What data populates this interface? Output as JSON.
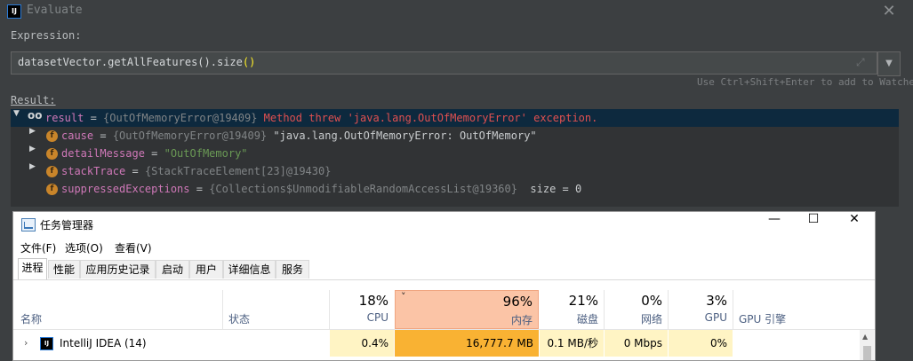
{
  "dialog": {
    "logo": "IJ",
    "title": "Evaluate",
    "close": "✕",
    "expression_label": "Expression:",
    "expression_prefix": "datasetVector.getAllFeatures().size",
    "expression_parens": "()",
    "dropdown": "▼",
    "hint": "Use Ctrl+Shift+Enter to add to Watches",
    "result_label": "Result:"
  },
  "result_tree": {
    "root": {
      "expand": "▼",
      "icon": "oo",
      "name": "result",
      "eq": " = ",
      "ref": "{OutOfMemoryError@19409}",
      "message": " Method threw 'java.lang.OutOfMemoryError' exception."
    },
    "children": [
      {
        "expand": "▶",
        "icon": "f",
        "name": "cause",
        "eq": " = ",
        "ref": "{OutOfMemoryError@19409}",
        "value": " \"java.lang.OutOfMemoryError: OutOfMemory\""
      },
      {
        "expand": "▶",
        "icon": "f",
        "name": "detailMessage",
        "eq": " = ",
        "ref": "",
        "value": "\"OutOfMemory\""
      },
      {
        "expand": "▶",
        "icon": "f",
        "name": "stackTrace",
        "eq": " = ",
        "ref": "{StackTraceElement[23]@19430}",
        "value": ""
      },
      {
        "expand": "",
        "icon": "f",
        "name": "suppressedExceptions",
        "eq": " = ",
        "ref": "{Collections$UnmodifiableRandomAccessList@19360}",
        "value": "  size = 0"
      }
    ]
  },
  "task_manager": {
    "title": "任务管理器",
    "window_buttons": {
      "minimize": "—",
      "maximize": "☐",
      "close": "✕"
    },
    "menu": [
      "文件(F)",
      "选项(O)",
      "查看(V)"
    ],
    "tabs": [
      "进程",
      "性能",
      "应用历史记录",
      "启动",
      "用户",
      "详细信息",
      "服务"
    ],
    "active_tab": "进程",
    "columns": {
      "name": "名称",
      "status": "状态",
      "cpu": {
        "pct": "18%",
        "label": "CPU"
      },
      "memory": {
        "pct": "96%",
        "label": "内存",
        "sort": "˅"
      },
      "disk": {
        "pct": "21%",
        "label": "磁盘"
      },
      "network": {
        "pct": "0%",
        "label": "网络"
      },
      "gpu": {
        "pct": "3%",
        "label": "GPU"
      },
      "gpu_engine": "GPU 引擎"
    },
    "process": {
      "expand": "›",
      "icon": "IJ",
      "name": "IntelliJ IDEA (14)",
      "cpu": "0.4%",
      "memory": "16,777.7 MB",
      "disk": "0.1 MB/秒",
      "network": "0 Mbps",
      "gpu": "0%"
    },
    "scrollbar_arrow": "▲"
  },
  "colors": {
    "dialog_bg": "#3c3f41",
    "tree_bg": "#313335",
    "selected_row": "#0d293e",
    "var_name": "#cf78b8",
    "error_text": "#e05050",
    "string_value": "#6a9955",
    "mem_header": "#fbc4a6",
    "mem_cell": "#f9b233",
    "cell_highlight": "#fff4c4"
  }
}
